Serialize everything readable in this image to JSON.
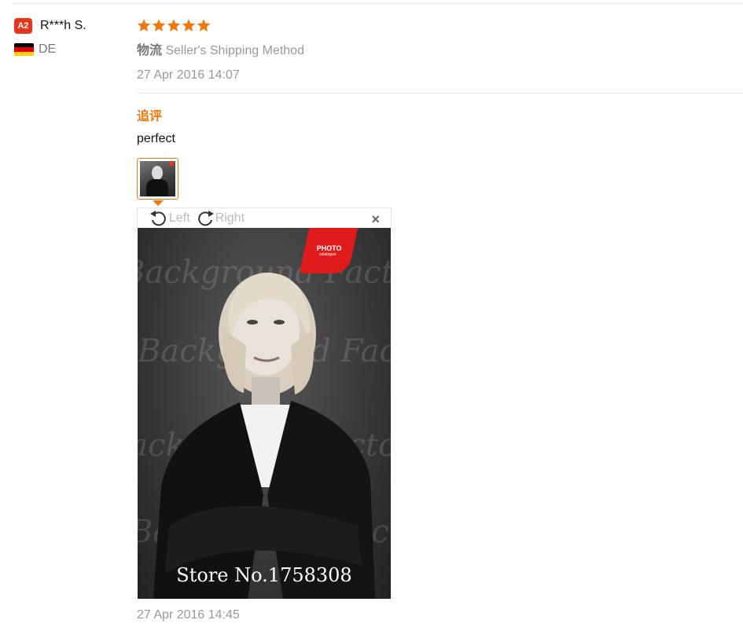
{
  "user": {
    "level_badge": "A2",
    "name": "R***h S.",
    "country_code": "DE",
    "flag_colors": [
      "#000000",
      "#dd0000",
      "#ffce00"
    ]
  },
  "review": {
    "rating": 5,
    "rating_max": 5,
    "star_color": "#f2780c",
    "shipping_label": "物流",
    "shipping_method": "Seller's Shipping Method",
    "date": "27 Apr 2016 14:07"
  },
  "followup": {
    "label": "追评",
    "text": "perfect",
    "date": "27 Apr 2016 14:45"
  },
  "viewer": {
    "rotate_left_label": "Left",
    "rotate_right_label": "Right",
    "close_glyph": "×",
    "photo_tag_title": "PHOTO",
    "photo_tag_sub": "catalogue",
    "watermark_text": "Background Factory",
    "caption": "Store No.1758308"
  },
  "colors": {
    "accent": "#f2780c",
    "badge": "#e8361c",
    "muted_text": "#999999"
  }
}
